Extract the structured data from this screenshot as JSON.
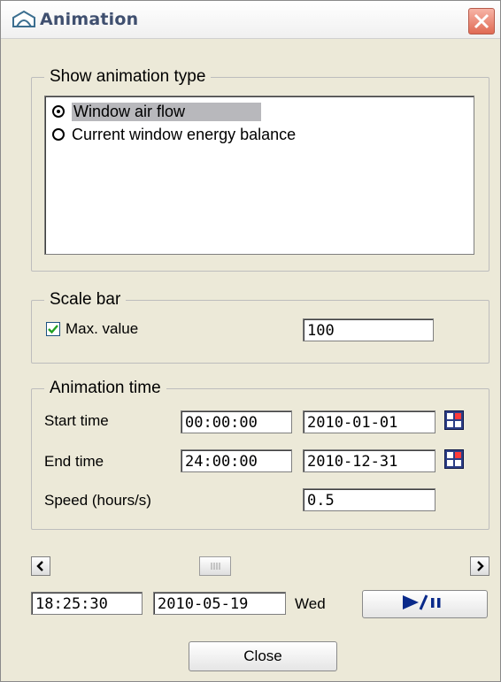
{
  "window": {
    "title": "Animation"
  },
  "animation_type": {
    "legend": "Show animation type",
    "options": [
      {
        "label": "Window air flow",
        "selected": true
      },
      {
        "label": "Current window energy balance",
        "selected": false
      }
    ]
  },
  "scale_bar": {
    "legend": "Scale bar",
    "max_checked": true,
    "max_label": "Max. value",
    "max_value": "100"
  },
  "animation_time": {
    "legend": "Animation time",
    "start_label": "Start time",
    "start_time": "00:00:00",
    "start_date": "2010-01-01",
    "end_label": "End time",
    "end_time": "24:00:00",
    "end_date": "2010-12-31",
    "speed_label": "Speed (hours/s)",
    "speed_value": "0.5"
  },
  "playback": {
    "current_time": "18:25:30",
    "current_date": "2010-05-19",
    "weekday": "Wed",
    "play_pause_icon": "play-pause-icon"
  },
  "footer": {
    "close_label": "Close"
  },
  "colors": {
    "title_text": "#3f4f6f",
    "highlight": "#b8b8bc",
    "calendar_icon": "#2c3e86",
    "checkbox_tick": "#1c5180"
  }
}
